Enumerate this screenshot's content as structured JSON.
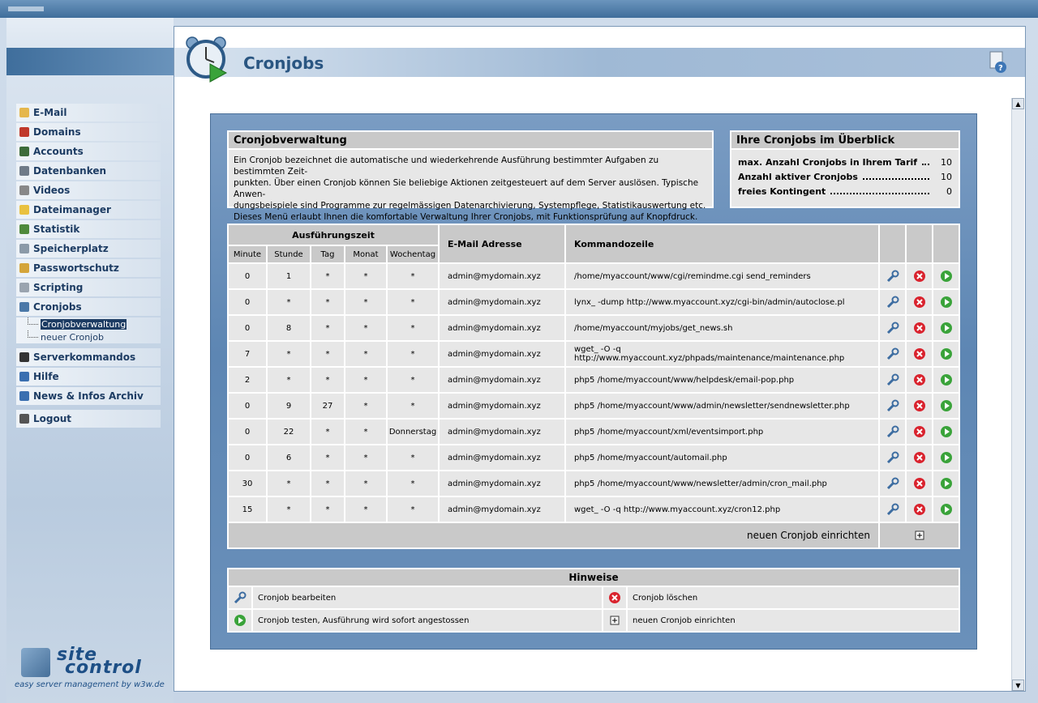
{
  "window": {
    "title_tag": ""
  },
  "page": {
    "title": "Cronjobs"
  },
  "sidebar": {
    "items": [
      {
        "label": "E-Mail",
        "icon": "email-icon",
        "color": "#e5b74c"
      },
      {
        "label": "Domains",
        "icon": "domains-icon",
        "color": "#c0392b"
      },
      {
        "label": "Accounts",
        "icon": "accounts-icon",
        "color": "#3d6c3a"
      },
      {
        "label": "Datenbanken",
        "icon": "database-icon",
        "color": "#6f7b88"
      },
      {
        "label": "Videos",
        "icon": "video-icon",
        "color": "#888888"
      },
      {
        "label": "Dateimanager",
        "icon": "folder-icon",
        "color": "#e9c13f"
      },
      {
        "label": "Statistik",
        "icon": "chart-icon",
        "color": "#4f8a3c"
      },
      {
        "label": "Speicherplatz",
        "icon": "storage-icon",
        "color": "#8b9aa8"
      },
      {
        "label": "Passwortschutz",
        "icon": "lock-icon",
        "color": "#d4a53a"
      },
      {
        "label": "Scripting",
        "icon": "script-icon",
        "color": "#9aa4af"
      },
      {
        "label": "Cronjobs",
        "icon": "clock-icon",
        "color": "#4a78a8"
      }
    ],
    "subitems": [
      "Cronjobverwaltung",
      "neuer Cronjob"
    ],
    "items2": [
      {
        "label": "Serverkommandos",
        "icon": "terminal-icon",
        "color": "#333333"
      },
      {
        "label": "Hilfe",
        "icon": "help-icon",
        "color": "#3a6fb0"
      },
      {
        "label": "News & Infos Archiv",
        "icon": "info-icon",
        "color": "#3a6fb0"
      }
    ],
    "logout": {
      "label": "Logout",
      "icon": "logout-icon",
      "color": "#555555"
    },
    "logo": {
      "line1": "site",
      "line2": "control",
      "tagline": "easy server management by w3w.de"
    }
  },
  "verwaltung": {
    "title": "Cronjobverwaltung",
    "text": [
      "Ein Cronjob bezeichnet die automatische und wiederkehrende Ausführung bestimmter Aufgaben zu bestimmten Zeit-",
      "punkten. Über einen Cronjob können Sie beliebige Aktionen zeitgesteuert auf dem Server auslösen. Typische Anwen-",
      "dungsbeispiele sind Programme zur regelmässigen Datenarchivierung, Systempflege, Statistikauswertung etc.",
      "Dieses Menü erlaubt Ihnen die komfortable Verwaltung Ihrer Cronjobs, mit Funktionsprüfung auf Knopfdruck."
    ]
  },
  "overview": {
    "title": "Ihre Cronjobs im Überblick",
    "rows": [
      {
        "label": "max. Anzahl Cronjobs in Ihrem Tarif",
        "value": "10"
      },
      {
        "label": "Anzahl aktiver Cronjobs",
        "value": "10"
      },
      {
        "label": "freies Kontingent",
        "value": "0"
      }
    ]
  },
  "table": {
    "group_header": "Ausführungszeit",
    "headers": [
      "Minute",
      "Stunde",
      "Tag",
      "Monat",
      "Wochentag"
    ],
    "email_header": "E-Mail Adresse",
    "command_header": "Kommandozeile",
    "rows": [
      {
        "minute": "0",
        "stunde": "1",
        "tag": "*",
        "monat": "*",
        "wochentag": "*",
        "email": "admin@mydomain.xyz",
        "cmd": "/home/myaccount/www/cgi/remindme.cgi send_reminders"
      },
      {
        "minute": "0",
        "stunde": "*",
        "tag": "*",
        "monat": "*",
        "wochentag": "*",
        "email": "admin@mydomain.xyz",
        "cmd": "lynx_ -dump http://www.myaccount.xyz/cgi-bin/admin/autoclose.pl"
      },
      {
        "minute": "0",
        "stunde": "8",
        "tag": "*",
        "monat": "*",
        "wochentag": "*",
        "email": "admin@mydomain.xyz",
        "cmd": "/home/myaccount/myjobs/get_news.sh"
      },
      {
        "minute": "7",
        "stunde": "*",
        "tag": "*",
        "monat": "*",
        "wochentag": "*",
        "email": "admin@mydomain.xyz",
        "cmd": "wget_ -O -q http://www.myaccount.xyz/phpads/maintenance/maintenance.php"
      },
      {
        "minute": "2",
        "stunde": "*",
        "tag": "*",
        "monat": "*",
        "wochentag": "*",
        "email": "admin@mydomain.xyz",
        "cmd": "php5 /home/myaccount/www/helpdesk/email-pop.php"
      },
      {
        "minute": "0",
        "stunde": "9",
        "tag": "27",
        "monat": "*",
        "wochentag": "*",
        "email": "admin@mydomain.xyz",
        "cmd": "php5 /home/myaccount/www/admin/newsletter/sendnewsletter.php"
      },
      {
        "minute": "0",
        "stunde": "22",
        "tag": "*",
        "monat": "*",
        "wochentag": "Donnerstag",
        "email": "admin@mydomain.xyz",
        "cmd": "php5 /home/myaccount/xml/eventsimport.php"
      },
      {
        "minute": "0",
        "stunde": "6",
        "tag": "*",
        "monat": "*",
        "wochentag": "*",
        "email": "admin@mydomain.xyz",
        "cmd": "php5 /home/myaccount/automail.php"
      },
      {
        "minute": "30",
        "stunde": "*",
        "tag": "*",
        "monat": "*",
        "wochentag": "*",
        "email": "admin@mydomain.xyz",
        "cmd": "php5 /home/myaccount/www/newsletter/admin/cron_mail.php"
      },
      {
        "minute": "15",
        "stunde": "*",
        "tag": "*",
        "monat": "*",
        "wochentag": "*",
        "email": "admin@mydomain.xyz",
        "cmd": "wget_ -O -q http://www.myaccount.xyz/cron12.php"
      }
    ],
    "new_label": "neuen Cronjob einrichten"
  },
  "hinweise": {
    "title": "Hinweise",
    "edit": "Cronjob bearbeiten",
    "delete": "Cronjob löschen",
    "test": "Cronjob testen, Ausführung wird sofort angestossen",
    "add": "neuen Cronjob einrichten"
  },
  "colors": {
    "accent": "#2a5682",
    "delete": "#d9232e",
    "run": "#3aa33a"
  }
}
